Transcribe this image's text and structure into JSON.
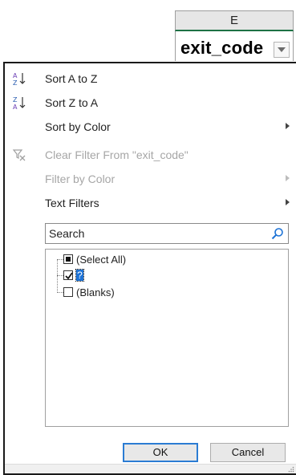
{
  "sheet": {
    "column_letter": "E",
    "field_name": "exit_code"
  },
  "menu": {
    "sort_asc": "Sort A to Z",
    "sort_desc": "Sort Z to A",
    "sort_by_color": "Sort by Color",
    "clear_filter": "Clear Filter From \"exit_code\"",
    "filter_by_color": "Filter by Color",
    "text_filters": "Text Filters"
  },
  "search": {
    "placeholder": "Search"
  },
  "values": {
    "select_all": "(Select All)",
    "selected_value": "?",
    "blanks": "(Blanks)"
  },
  "buttons": {
    "ok": "OK",
    "cancel": "Cancel"
  },
  "colors": {
    "header_border": "#1e7145",
    "selection": "#1e73d6",
    "ok_border": "#2b7cd3"
  }
}
